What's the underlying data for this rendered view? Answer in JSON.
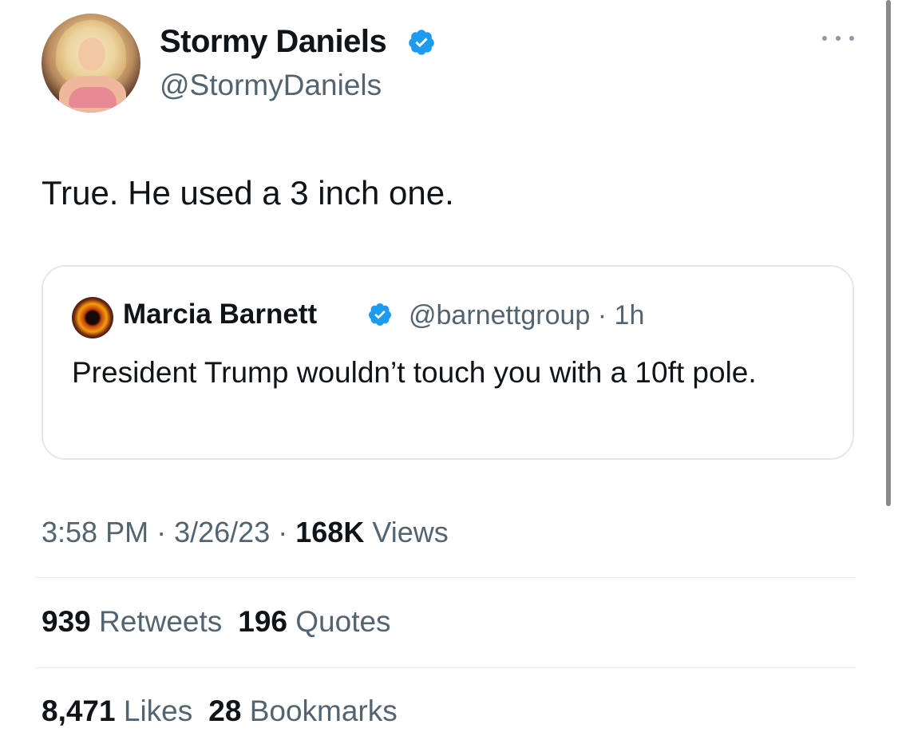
{
  "author": {
    "name": "Stormy Daniels",
    "handle": "@StormyDaniels",
    "verified": true,
    "avatar_icon": "profile-photo"
  },
  "tweet_text": "True. He used a 3 inch one.",
  "more_icon": "more-dots-icon",
  "quoted_tweet": {
    "name": "Marcia Barnett",
    "handle_time": "@barnettgroup · 1h",
    "verified": true,
    "text": "President Trump wouldn’t touch you with a 10ft pole."
  },
  "meta": {
    "time": "3:58 PM",
    "date": "3/26/23",
    "separator": "·",
    "views_count": "168K",
    "views_label": "Views"
  },
  "stats_row1": {
    "retweets_count": "939",
    "retweets_label": "Retweets",
    "quotes_count": "196",
    "quotes_label": "Quotes"
  },
  "stats_row2": {
    "likes_count": "8,471",
    "likes_label": "Likes",
    "bookmarks_count": "28",
    "bookmarks_label": "Bookmarks"
  },
  "colors": {
    "verified_blue": "#1d9bf0",
    "text_primary": "#0f1419",
    "text_secondary": "#536471",
    "border": "#e1e8ed"
  }
}
